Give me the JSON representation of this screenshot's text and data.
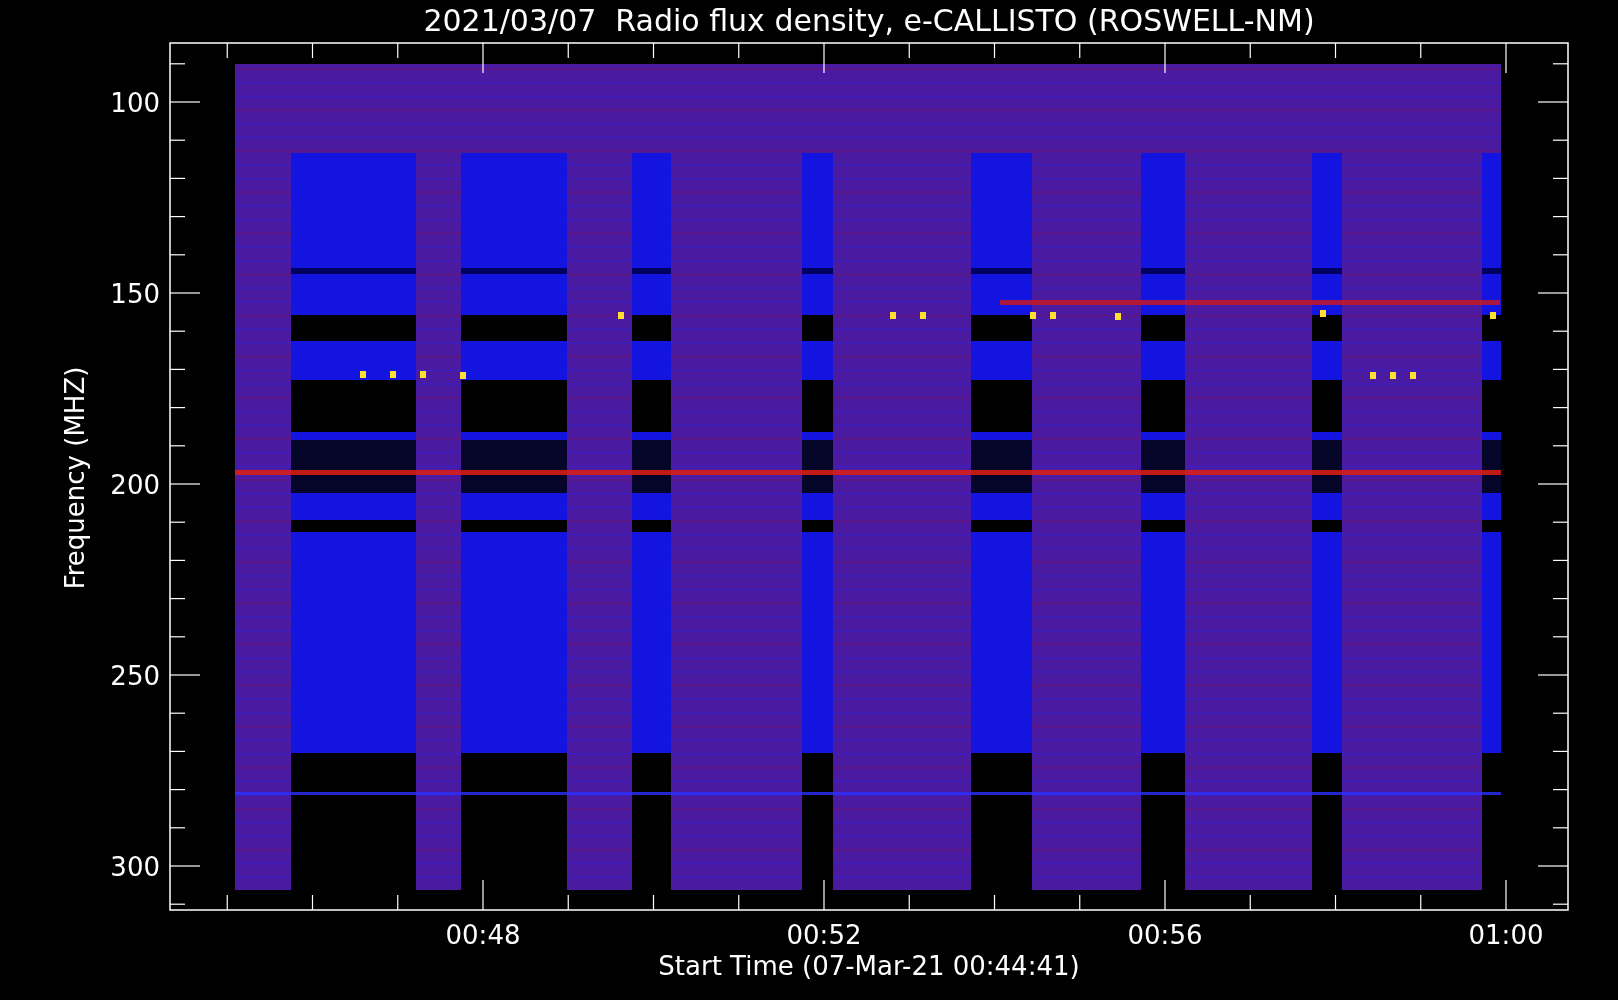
{
  "title": "2021/03/07  Radio flux density, e-CALLISTO (ROSWELL-NM)",
  "y_axis": {
    "label": "Frequency (MHZ)",
    "ticks": [
      "100",
      "150",
      "200",
      "250",
      "300"
    ]
  },
  "x_axis": {
    "label": "Start Time (07-Mar-21 00:44:41)",
    "ticks": [
      "00:48",
      "00:52",
      "00:56",
      "01:00"
    ]
  }
}
